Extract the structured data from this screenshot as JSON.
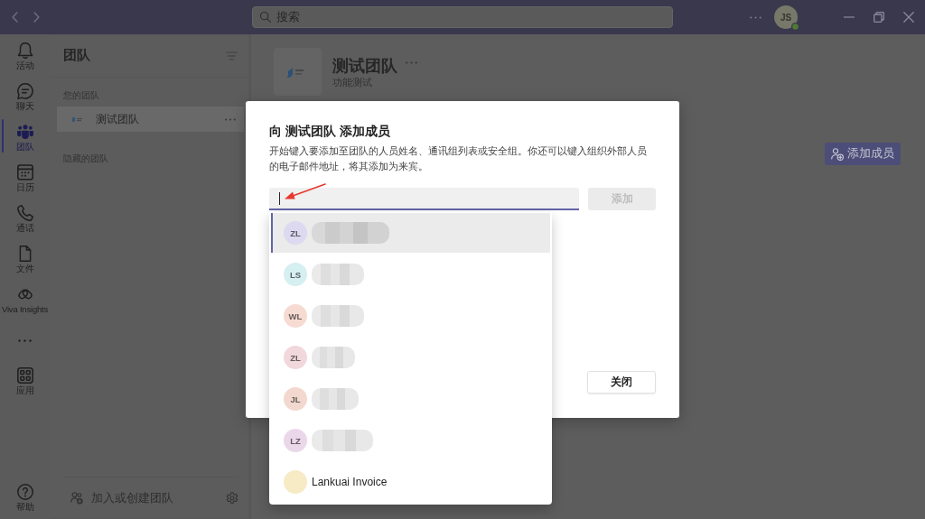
{
  "title_bar": {
    "search": {
      "placeholder": "搜索"
    },
    "avatar": {
      "initials": "JS",
      "online": true
    }
  },
  "app_bar": {
    "items": [
      {
        "kind": "activity",
        "label": "活动",
        "selected": false
      },
      {
        "kind": "chat",
        "label": "聊天",
        "selected": false
      },
      {
        "kind": "teams",
        "label": "团队",
        "selected": true
      },
      {
        "kind": "calendar",
        "label": "日历",
        "selected": false
      },
      {
        "kind": "calls",
        "label": "通话",
        "selected": false
      },
      {
        "kind": "files",
        "label": "文件",
        "selected": false
      },
      {
        "kind": "viva",
        "label": "Viva Insights",
        "selected": false
      },
      {
        "kind": "more",
        "selected": false
      },
      {
        "kind": "apps",
        "label": "应用",
        "selected": false
      }
    ],
    "bottom_items": [
      {
        "kind": "help",
        "label": "帮助",
        "selected": false
      }
    ]
  },
  "teams_pane": {
    "title": "团队",
    "sections": [
      {
        "heading": "您的团队",
        "teams": [
          {
            "name": "测试团队",
            "selected": true
          }
        ]
      },
      {
        "heading": "隐藏的团队"
      }
    ],
    "footer": {
      "label": "加入或创建团队"
    }
  },
  "team_header": {
    "name": "测试团队",
    "description": "功能测试"
  },
  "toolbar": {
    "add_member_button": {
      "label": "添加成员"
    }
  },
  "dialog": {
    "title": "向 测试团队 添加成员",
    "description": "开始键入要添加至团队的人员姓名、通讯组列表或安全组。你还可以键入组织外部人员的电子邮件地址，将其添加为来宾。",
    "add_button": {
      "label": "添加",
      "disabled": true
    },
    "suggestions": [
      {
        "initials": "ZL",
        "color": "#dcd9f0",
        "selected": true
      },
      {
        "initials": "LS",
        "color": "#d6eff1",
        "selected": false
      },
      {
        "initials": "WL",
        "color": "#f6dbd3",
        "selected": false
      },
      {
        "initials": "ZL",
        "color": "#f1d8dc",
        "selected": false
      },
      {
        "initials": "JL",
        "color": "#f2d8cf",
        "selected": false
      },
      {
        "initials": "LZ",
        "color": "#ebd7ea",
        "selected": false
      },
      {
        "name": "Lankuai Invoice",
        "color": "#f7ebc6",
        "selected": false
      }
    ],
    "close_button": {
      "label": "关闭"
    }
  }
}
